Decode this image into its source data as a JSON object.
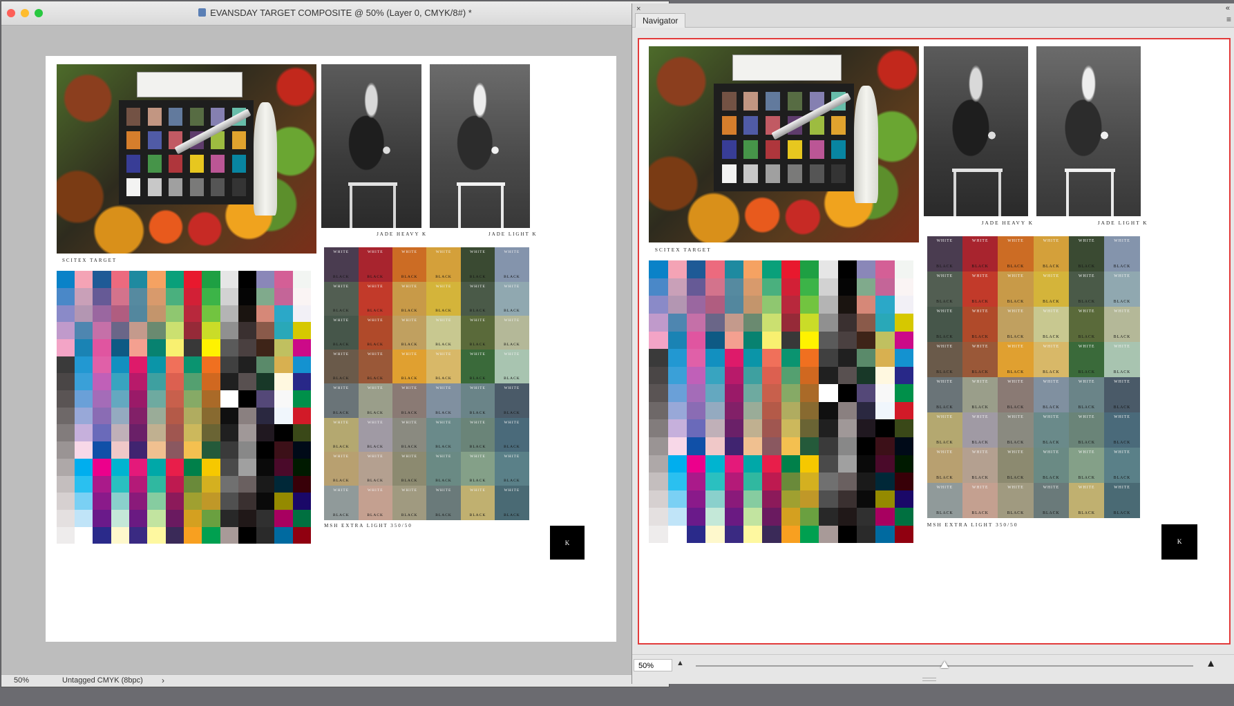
{
  "window": {
    "title": "EVANSDAY TARGET COMPOSITE @ 50% (Layer 0, CMYK/8#) *",
    "traffic_lights": [
      "#fd5f57",
      "#febc2e",
      "#28c840"
    ],
    "file_icon": "photoshop-document-icon"
  },
  "status": {
    "zoom": "50%",
    "profile": "Untagged CMYK (8bpc)",
    "arrow": "›"
  },
  "navigator": {
    "tab_label": "Navigator",
    "close_glyph": "×",
    "collapse_glyph": "«",
    "menu_glyph": "≡",
    "zoom_value": "50%",
    "zoom_out_glyph": "▲",
    "zoom_in_glyph": "▲",
    "slider_level": 0.5,
    "proxy_color": "#e23a3a"
  },
  "document": {
    "captions": {
      "scitex": "SCITEX TARGET",
      "jade_heavy": "JADE HEAVY K",
      "jade_light": "JADE LIGHT K",
      "msh": "MSH EXTRA LIGHT 350/50"
    },
    "k_label": "K",
    "macbeth_colors": [
      "#735244",
      "#c29682",
      "#627a9d",
      "#576c43",
      "#8580b1",
      "#67bdaa",
      "#d67e2c",
      "#505ba6",
      "#c15a63",
      "#5e3c6c",
      "#9dbc40",
      "#e0a32e",
      "#383d96",
      "#469449",
      "#af363c",
      "#e7c71f",
      "#bb5695",
      "#0885a1",
      "#f3f3f2",
      "#c8c8c8",
      "#a0a0a0",
      "#7a7a79",
      "#555555",
      "#343434"
    ],
    "cmy_patches": [
      "#0a82c8",
      "#f4a3b5",
      "#1e5a96",
      "#ec6a7e",
      "#1e8aa0",
      "#f5a262",
      "#09a07a",
      "#e8192e",
      "#1ea043",
      "#e6e6e6",
      "#000000",
      "#8a87b8",
      "#d45f96",
      "#f2f5f2",
      "#4a88c8",
      "#c9a0b8",
      "#665a96",
      "#d3738c",
      "#568aa0",
      "#d89a6c",
      "#4ab07e",
      "#d22036",
      "#3cb448",
      "#d2d2d2",
      "#050505",
      "#80aa8c",
      "#c46598",
      "#faf4f4",
      "#8a8ac8",
      "#b396b2",
      "#9a67a0",
      "#b05d80",
      "#53879e",
      "#c3956c",
      "#8fc770",
      "#b8283c",
      "#72c440",
      "#b4b4b4",
      "#1a1410",
      "#d68878",
      "#2ba8c8",
      "#f2f0f6",
      "#c09acb",
      "#4e86b0",
      "#c570a8",
      "#6a6688",
      "#c49a8c",
      "#6a8a70",
      "#cbe070",
      "#962a38",
      "#cadc28",
      "#909090",
      "#3a3030",
      "#8a5a4a",
      "#29a8b8",
      "#d6c800",
      "#f3a4c6",
      "#1a83b4",
      "#e055a0",
      "#0e5a84",
      "#f4a090",
      "#088270",
      "#f8f070",
      "#383838",
      "#fff200",
      "#5a5a5a",
      "#4a4040",
      "#3e2418",
      "#c0c060",
      "#cc0a88",
      "#3a3a3a",
      "#2298d2",
      "#e060a8",
      "#1290c0",
      "#de1a6a",
      "#0b95a8",
      "#f0705a",
      "#0a9470",
      "#f07020",
      "#404040",
      "#202020",
      "#5a8a6a",
      "#d8b050",
      "#1492d0",
      "#4a4646",
      "#3aa0d8",
      "#c060b8",
      "#38a4c0",
      "#b81a6a",
      "#3ea0a0",
      "#dc6050",
      "#54a070",
      "#d06820",
      "#202020",
      "#585050",
      "#183828",
      "#fff8e0",
      "#282888",
      "#5a5454",
      "#6aa0d8",
      "#a46cb8",
      "#64a8c0",
      "#9a1a68",
      "#6eaaa0",
      "#c8604c",
      "#86aa66",
      "#aa6a28",
      "#ffffff",
      "#000000",
      "#544878",
      "#f8f8f8",
      "#00904a",
      "#6e6868",
      "#98a8d8",
      "#8a6cb4",
      "#94aac0",
      "#822068",
      "#9aac98",
      "#b45a48",
      "#b0ac60",
      "#886a30",
      "#101010",
      "#8a8080",
      "#2a2840",
      "#f0f6fc",
      "#d21a28",
      "#827c7c",
      "#c6b0dc",
      "#6a6aba",
      "#c0b0b8",
      "#6a2068",
      "#c0b090",
      "#a05650",
      "#ccb85c",
      "#6a6434",
      "#202020",
      "#a09898",
      "#201820",
      "#000000",
      "#3a4818",
      "#9a9494",
      "#f8d8e8",
      "#1050a8",
      "#f0c8c8",
      "#402470",
      "#f0c090",
      "#8a5860",
      "#f4c050",
      "#245a3a",
      "#3a3a3a",
      "#888888",
      "#000000",
      "#3c1018",
      "#000a18",
      "#aea8a8",
      "#00aeee",
      "#ec008c",
      "#00b4d0",
      "#e4197a",
      "#00a8a8",
      "#e81e4a",
      "#00804a",
      "#f6c800",
      "#4a4a4a",
      "#a0a0a0",
      "#0a0a0a",
      "#4a0a2a",
      "#001a00",
      "#c4bebe",
      "#2ac0f0",
      "#aa1a8a",
      "#2ac0c0",
      "#b41a78",
      "#30b8a0",
      "#be1a50",
      "#6a8a3a",
      "#d4b020",
      "#707070",
      "#6a6060",
      "#1a1a1a",
      "#002838",
      "#380008",
      "#d6d0d0",
      "#7ad0f4",
      "#8a1a8a",
      "#8ad0cc",
      "#8a1a7a",
      "#86cca0",
      "#8c1a5a",
      "#a0a030",
      "#c09828",
      "#505050",
      "#3a3030",
      "#0a0a0a",
      "#948a00",
      "#1a0868",
      "#e4e0e0",
      "#c0e4f8",
      "#6a1a8a",
      "#c4e8d8",
      "#6a1a82",
      "#c2e4a0",
      "#6a1a60",
      "#d4a020",
      "#6aa040",
      "#282828",
      "#201818",
      "#303030",
      "#a80060",
      "#007040",
      "#eeecec",
      "#ffffff",
      "#2a2a8a",
      "#fef8cc",
      "#3a2a82",
      "#fef8a0",
      "#3a2a58",
      "#f8a020",
      "#00a050",
      "#a89a98",
      "#000000",
      "#2a2a2a",
      "#006aa0",
      "#900010"
    ],
    "gray_grid": {
      "columns": 6,
      "rows": 8,
      "white_label": "WHITE",
      "black_label": "BLACK",
      "colors": [
        "#4a3c50",
        "#a8242e",
        "#cc6c24",
        "#d4a03a",
        "#3a4a32",
        "#8494ac",
        "#525e52",
        "#c23a2a",
        "#c89a48",
        "#d4b43a",
        "#4a5a48",
        "#90a8b0",
        "#46564a",
        "#b04a2a",
        "#c0a060",
        "#c8c890",
        "#5a6a3a",
        "#b4b898",
        "#6a5a4a",
        "#9a5838",
        "#e0a030",
        "#d8b868",
        "#3a6a3a",
        "#a8c4b0",
        "#6a7478",
        "#9a9e8a",
        "#8a7a74",
        "#8090a0",
        "#6a8488",
        "#4a5a68",
        "#b4a870",
        "#a09aa4",
        "#8a8a80",
        "#6a8a8a",
        "#6a8478",
        "#4a6a7a",
        "#b8a070",
        "#b4a090",
        "#8c8a70",
        "#6a8a84",
        "#84a088",
        "#5a8088",
        "#909a9a",
        "#c4a090",
        "#a09a80",
        "#6a7a7a",
        "#c0b070",
        "#4a6a74"
      ]
    }
  }
}
